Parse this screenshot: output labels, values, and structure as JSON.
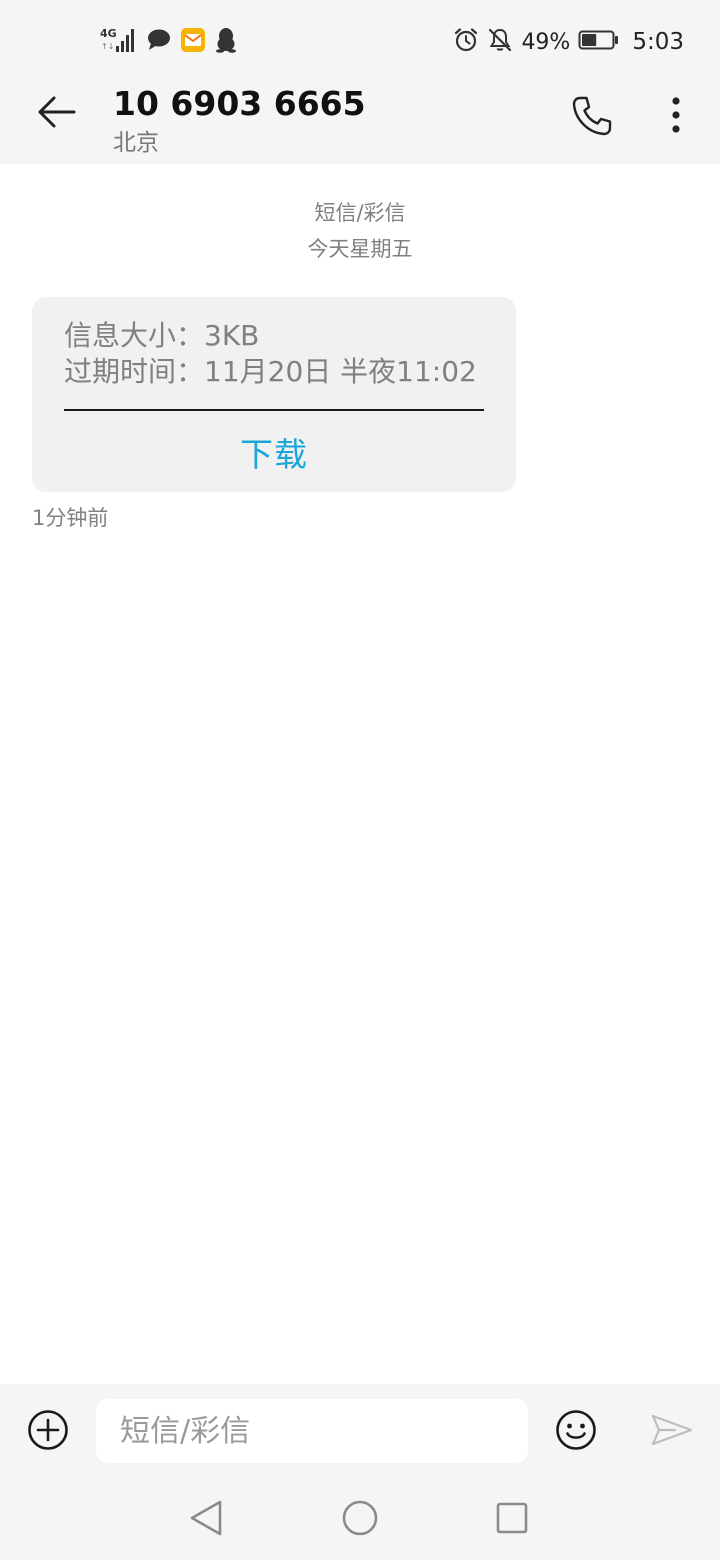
{
  "status_bar": {
    "network_label": "4G",
    "battery_percent": "49%",
    "battery_level": 0.49,
    "time": "5:03",
    "icons": [
      "signal-icon",
      "chat-bubble-icon",
      "mail-app-icon",
      "penguin-app-icon",
      "alarm-icon",
      "bell-off-icon",
      "battery-icon"
    ],
    "colors": {
      "mail_app": "#f5b400",
      "mail_app_flap": "#ff6a00"
    }
  },
  "header": {
    "contact_name": "10 6903 6665",
    "contact_location": "北京",
    "icons": [
      "back-arrow-icon",
      "phone-icon",
      "more-vertical-icon"
    ]
  },
  "conversation": {
    "message_type": "短信/彩信",
    "date_label": "今天星期五",
    "mms": {
      "size_line": "信息大小：3KB",
      "expiry_line": "过期时间：11月20日 半夜11:02",
      "download_label": "下载"
    },
    "timestamp": "1分钟前",
    "colors": {
      "accent": "#1aa6d8",
      "bubble": "#f1f1f1"
    }
  },
  "composer": {
    "placeholder": "短信/彩信",
    "value": "",
    "icons": [
      "add-circle-icon",
      "emoji-icon",
      "send-icon"
    ]
  },
  "nav_bar": {
    "icons": [
      "nav-back-icon",
      "nav-home-icon",
      "nav-recents-icon"
    ]
  }
}
